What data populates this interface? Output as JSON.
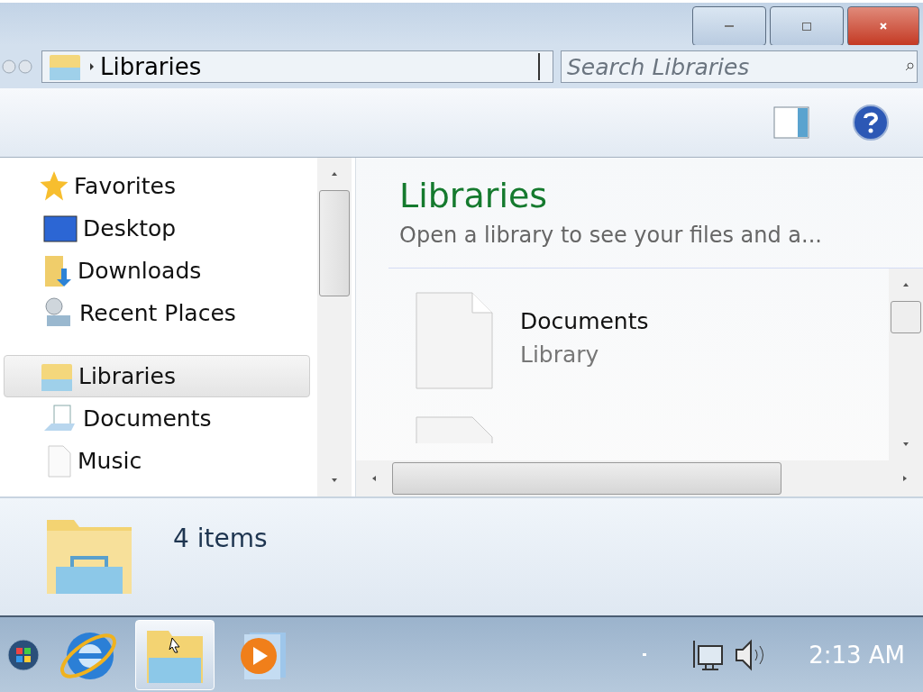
{
  "address_bar": {
    "path": "Libraries"
  },
  "search": {
    "placeholder": "Search Libraries"
  },
  "navigation_pane": {
    "groups": [
      {
        "label": "Favorites",
        "selected": false,
        "children": [
          {
            "label": "Desktop",
            "selected": false
          },
          {
            "label": "Downloads",
            "selected": false
          },
          {
            "label": "Recent Places",
            "selected": false
          }
        ]
      },
      {
        "label": "Libraries",
        "selected": true,
        "children": [
          {
            "label": "Documents",
            "selected": false
          },
          {
            "label": "Music",
            "selected": false
          }
        ]
      }
    ]
  },
  "content": {
    "title": "Libraries",
    "subtitle": "Open a library to see your files and a...",
    "items": [
      {
        "name": "Documents",
        "type": "Library"
      }
    ]
  },
  "details_pane": {
    "summary": "4 items"
  },
  "taskbar": {
    "apps": [
      {
        "selected": false
      },
      {
        "selected": true
      },
      {
        "selected": false
      }
    ],
    "clock": "2:13 AM"
  }
}
